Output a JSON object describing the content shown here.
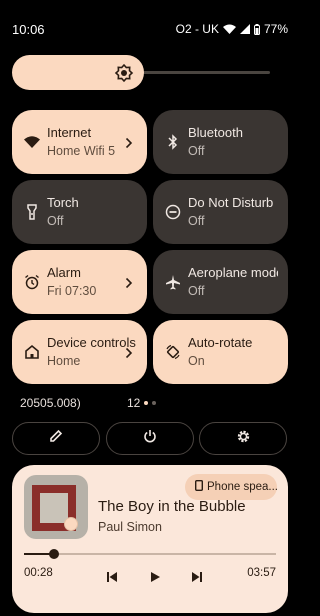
{
  "status_bar": {
    "time": "10:06",
    "carrier": "O2 - UK",
    "battery_percent": "77%"
  },
  "brightness": {
    "level": 0.5,
    "icon": "brightness-icon"
  },
  "tiles": [
    {
      "title": "Internet",
      "subtitle": "Home Wifi 5",
      "state": "on",
      "icon": "wifi-icon",
      "has_chevron": true
    },
    {
      "title": "Bluetooth",
      "subtitle": "Off",
      "state": "off",
      "icon": "bluetooth-icon",
      "has_chevron": false
    },
    {
      "title": "Torch",
      "subtitle": "Off",
      "state": "off",
      "icon": "torch-icon",
      "has_chevron": false
    },
    {
      "title": "Do Not Disturb",
      "subtitle": "Off",
      "state": "off",
      "icon": "do-not-disturb-icon",
      "has_chevron": false
    },
    {
      "title": "Alarm",
      "subtitle": "Fri 07:30",
      "state": "on",
      "icon": "alarm-icon",
      "has_chevron": true
    },
    {
      "title": "Aeroplane mode",
      "subtitle": "Off",
      "state": "off",
      "icon": "aeroplane-icon",
      "has_chevron": false
    },
    {
      "title": "Device controls",
      "subtitle": "Home",
      "state": "on",
      "icon": "home-icon",
      "has_chevron": true
    },
    {
      "title": "Auto-rotate",
      "subtitle": "On",
      "state": "on",
      "icon": "auto-rotate-icon",
      "has_chevron": false
    }
  ],
  "footer": {
    "build_number": "20505.008)",
    "page_indicator": "12",
    "pages": 2,
    "current_page": 1
  },
  "actions": [
    {
      "name": "edit",
      "icon": "pencil-icon"
    },
    {
      "name": "power",
      "icon": "power-icon"
    },
    {
      "name": "settings",
      "icon": "gear-icon"
    }
  ],
  "media": {
    "output_device": "Phone speaker",
    "output_device_display": "Phone spea...",
    "title": "The Boy in the Bubble",
    "artist": "Paul Simon",
    "elapsed": "00:28",
    "total": "03:57",
    "progress": 0.118
  },
  "colors": {
    "tile_on": "#fbd9c0",
    "tile_off": "#3a3532",
    "media_bg": "#fbe7da",
    "background": "#000000"
  }
}
